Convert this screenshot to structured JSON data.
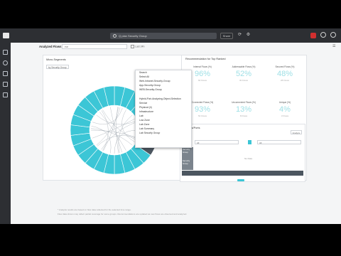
{
  "topbar": {
    "search_value": "Q   plan Security Group",
    "share_label": "Share"
  },
  "toolbar": {
    "breadcrumb": "Analyzed Flows",
    "filter_label": "ear",
    "checkbox_label": "Last 24h"
  },
  "left_panel": {
    "title": "Micro-Segments",
    "group_by_value": "by Security Group"
  },
  "right_panel": {
    "title": "Recommendation for Top Ranked",
    "metrics": [
      {
        "label": "Internal Flows (%)",
        "value": "96%",
        "sub": "60 Flows"
      },
      {
        "label": "Addressable Flows (%)",
        "value": "52%",
        "sub": "30 Flows"
      },
      {
        "label": "Secured Flows (%)",
        "value": "48%",
        "sub": "28 Flows"
      },
      {
        "label": "Connected Flows (%)",
        "value": "93%",
        "sub": "54 Flows"
      },
      {
        "label": "Unconnected Flows (%)",
        "value": "13%",
        "sub": "8 Flows"
      },
      {
        "label": "Unique (%)",
        "value": "4%",
        "sub": "3 Flows"
      }
    ]
  },
  "services_panel": {
    "title": "Services/Ports",
    "button_label": "Analyze",
    "left_select": "All",
    "right_select": "All",
    "row_labels": [
      "Security Group",
      "",
      "Security Group"
    ],
    "no_data_label": "No Data"
  },
  "dropdown": {
    "items": [
      "Search",
      "Select All",
      "Web-Intranet-Security-Group",
      "App-Security-Group",
      "WEB-Security-Group",
      "",
      "Hybrid-Pair-Analyzing-Object-Selection",
      "Service",
      "Physical (4)",
      "Infrastructure",
      "Lab",
      "Low Zone",
      "Lab Zone",
      "Lab Summary",
      "Lab Security Group"
    ]
  },
  "footnotes": {
    "line1": "* Analysis results are based on flow data collected for the selected time range.",
    "line2": "Flow data shown may reflect partial coverage for some groups. Recommendations are updated as new flows are observed and analyzed."
  },
  "chart_data": {
    "type": "pie",
    "title": "",
    "series": [
      {
        "values": [
          1,
          1,
          1,
          1,
          1,
          1,
          1,
          1,
          1,
          1,
          1,
          1,
          1,
          1,
          1,
          1,
          1,
          1,
          1,
          1,
          1,
          1,
          1,
          1,
          1,
          1
        ]
      }
    ],
    "colors": {
      "primary": "#3cc6d6",
      "secondary": "#4c5660"
    },
    "legend": ""
  },
  "colors": {
    "accent": "#3cc6d6",
    "dark": "#2d2f33"
  }
}
